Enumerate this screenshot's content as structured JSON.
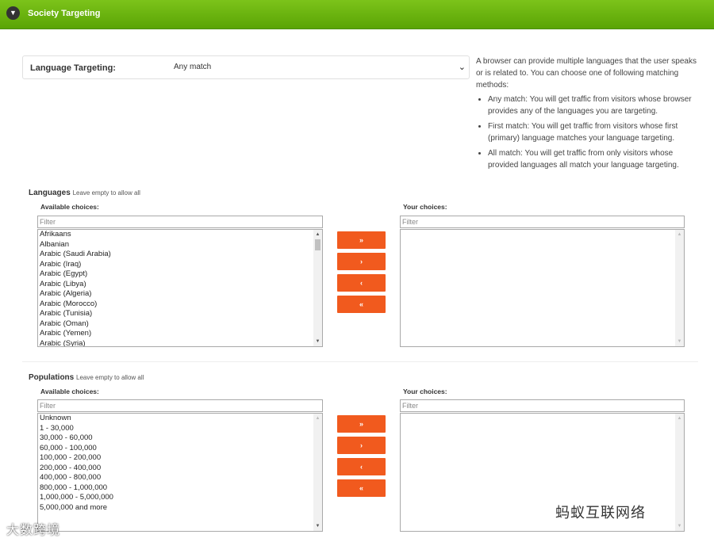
{
  "header": {
    "title": "Society Targeting",
    "toggle_icon": "▼"
  },
  "language_targeting": {
    "label": "Language Targeting:",
    "selected": "Any match",
    "chevron": "⌄"
  },
  "help": {
    "intro": "A browser can provide multiple languages that the user speaks or is related to. You can choose one of following matching methods:",
    "items": [
      "Any match: You will get traffic from visitors whose browser provides any of the languages you are targeting.",
      "First match: You will get traffic from visitors whose first (primary) language matches your language targeting.",
      "All match: You will get traffic from only visitors whose provided languages all match your language targeting."
    ]
  },
  "languages": {
    "title": "Languages",
    "hint": "Leave empty to allow all",
    "available_label": "Available choices:",
    "chosen_label": "Your choices:",
    "filter_placeholder": "Filter",
    "available": [
      "Afrikaans",
      "Albanian",
      "Arabic (Saudi Arabia)",
      "Arabic (Iraq)",
      "Arabic (Egypt)",
      "Arabic (Libya)",
      "Arabic (Algeria)",
      "Arabic (Morocco)",
      "Arabic (Tunisia)",
      "Arabic (Oman)",
      "Arabic (Yemen)",
      "Arabic (Syria)"
    ],
    "chosen": []
  },
  "populations": {
    "title": "Populations",
    "hint": "Leave empty to allow all",
    "available_label": "Available choices:",
    "chosen_label": "Your choices:",
    "filter_placeholder": "Filter",
    "available": [
      "Unknown",
      "1 - 30,000",
      "30,000 - 60,000",
      "60,000 - 100,000",
      "100,000 - 200,000",
      "200,000 - 400,000",
      "400,000 - 800,000",
      "800,000 - 1,000,000",
      "1,000,000 - 5,000,000",
      "5,000,000 and more"
    ],
    "chosen": []
  },
  "buttons": {
    "add_all": "»",
    "add": "›",
    "remove": "‹",
    "remove_all": "«"
  },
  "watermarks": {
    "right": "蚂蚁互联网络",
    "left": "大数跨境"
  },
  "colors": {
    "header_green": "#6cb50f",
    "button_orange": "#f15a1e"
  }
}
